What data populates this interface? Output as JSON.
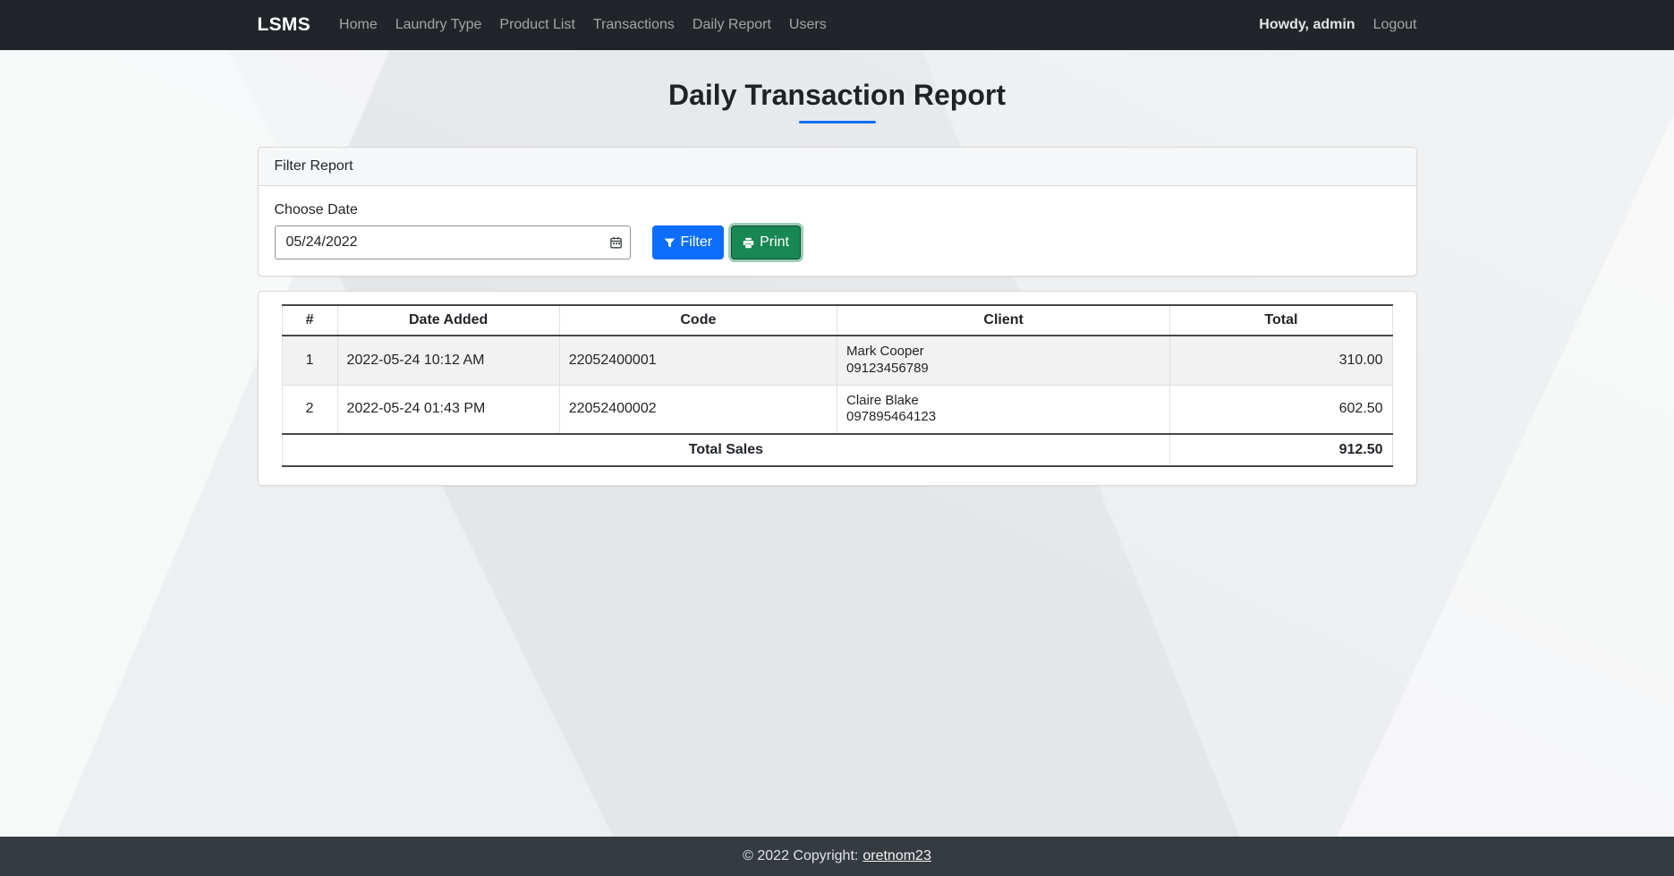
{
  "nav": {
    "brand": "LSMS",
    "items": [
      {
        "label": "Home"
      },
      {
        "label": "Laundry Type"
      },
      {
        "label": "Product List"
      },
      {
        "label": "Transactions"
      },
      {
        "label": "Daily Report"
      },
      {
        "label": "Users"
      }
    ],
    "greeting": "Howdy, admin",
    "logout": "Logout"
  },
  "page": {
    "title": "Daily Transaction Report"
  },
  "filter": {
    "header": "Filter Report",
    "date_label": "Choose Date",
    "date_value": "05/24/2022",
    "filter_button_label": "Filter",
    "print_button_label": "Print"
  },
  "report": {
    "columns": [
      "#",
      "Date Added",
      "Code",
      "Client",
      "Total"
    ],
    "rows": [
      {
        "num": "1",
        "date_added": "2022-05-24 10:12 AM",
        "code": "22052400001",
        "client_name": "Mark Cooper",
        "client_contact": "09123456789",
        "total": "310.00"
      },
      {
        "num": "2",
        "date_added": "2022-05-24 01:43 PM",
        "code": "22052400002",
        "client_name": "Claire Blake",
        "client_contact": "097895464123",
        "total": "602.50"
      }
    ],
    "footer_label": "Total Sales",
    "footer_total": "912.50"
  },
  "page_footer": {
    "text": "© 2022 Copyright:",
    "link_label": "oretnom23"
  },
  "colors": {
    "navbar_bg": "#212529",
    "primary": "#0d6efd",
    "success": "#198754",
    "title_underline": "#0d6efd",
    "footer_bg": "#363b40",
    "body_bg": "#e4e7ea"
  }
}
